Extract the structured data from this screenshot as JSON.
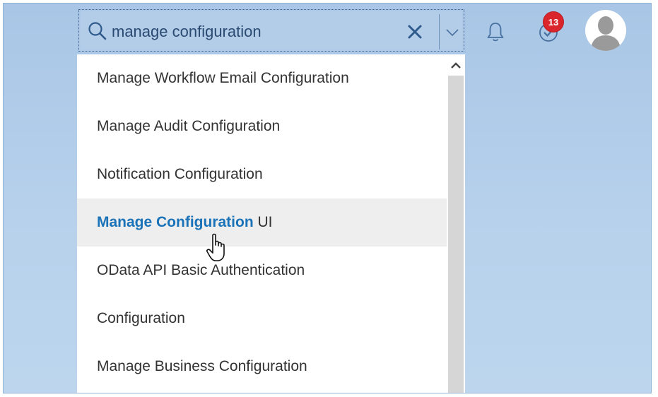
{
  "search": {
    "value": "manage configuration",
    "clear_icon": "close-icon",
    "dropdown_icon": "chevron-down-icon",
    "search_icon": "magnifier-icon"
  },
  "header": {
    "notifications_icon": "bell-icon",
    "tasks_icon": "task-check-icon",
    "tasks_badge": "13",
    "avatar_icon": "user-silhouette-icon"
  },
  "suggestions": [
    {
      "label": "Manage Workflow Email Configuration"
    },
    {
      "label": "Manage Audit Configuration"
    },
    {
      "label": "Notification Configuration"
    },
    {
      "match": "Manage Configuration",
      "rest": " UI"
    },
    {
      "label": "OData API Basic Authentication"
    },
    {
      "label": "Configuration"
    },
    {
      "label": "Manage Business Configuration"
    }
  ],
  "colors": {
    "background": "#b3cde9",
    "match_highlight": "#1a73b8",
    "badge": "#d9252b",
    "hover_row": "#eeeeee"
  }
}
